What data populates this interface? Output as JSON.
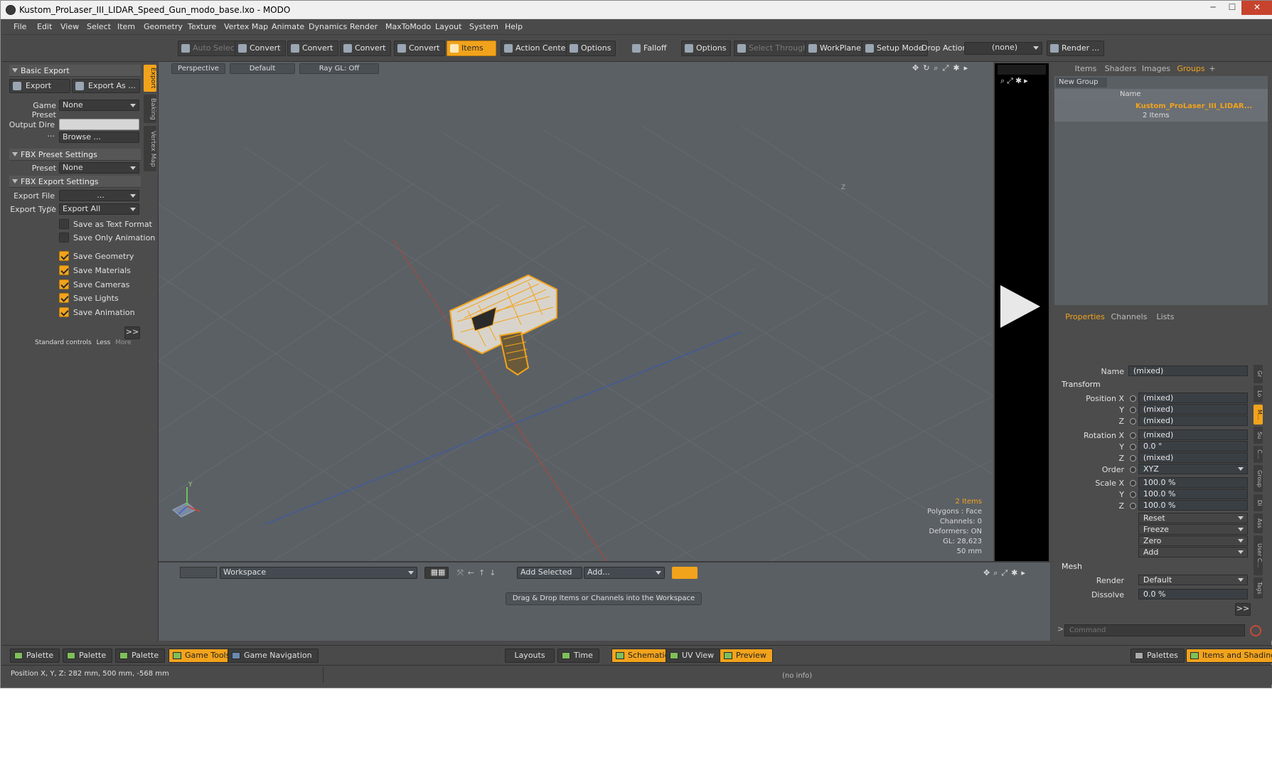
{
  "window": {
    "title": "Kustom_ProLaser_III_LIDAR_Speed_Gun_modo_base.lxo - MODO",
    "minimize": "─",
    "maximize": "☐",
    "close": "✕"
  },
  "menu": [
    "File",
    "Edit",
    "View",
    "Select",
    "Item",
    "Geometry",
    "Texture",
    "Vertex Map",
    "Animate",
    "Dynamics",
    "Render",
    "MaxToModo",
    "Layout",
    "System",
    "Help"
  ],
  "toolbar": {
    "auto_select": "Auto Select",
    "convert": "Convert",
    "items": "Items",
    "action_center": "Action Center",
    "options": "Options",
    "falloff": "Falloff",
    "select_through": "Select Through",
    "workplane": "WorkPlane",
    "setup_mode": "Setup Mode",
    "drop_action": "Drop Action",
    "drop_value": "(none)",
    "render": "Render ..."
  },
  "left": {
    "tabs": [
      "Export",
      "Baking",
      "Vertex Map"
    ],
    "basic_export": "Basic Export",
    "export_btn": "Export",
    "export_as_btn": "Export As ...",
    "game_preset_label": "Game Preset",
    "game_preset_value": "None",
    "output_dir_label": "Output Dire ...",
    "output_dir_value": "",
    "browse": "Browse ...",
    "fbx_preset_settings": "FBX Preset Settings",
    "preset_label": "Preset",
    "preset_value": "None",
    "fbx_export_settings": "FBX Export Settings",
    "export_file_label": "Export File ...",
    "export_file_value": "...",
    "export_type_label": "Export Type",
    "export_type_value": "Export All",
    "checkboxes": [
      {
        "label": "Save as Text Format",
        "checked": false
      },
      {
        "label": "Save Only Animation",
        "checked": false
      },
      {
        "label": "Save Geometry",
        "checked": true
      },
      {
        "label": "Save Materials",
        "checked": true
      },
      {
        "label": "Save Cameras",
        "checked": true
      },
      {
        "label": "Save Lights",
        "checked": true
      },
      {
        "label": "Save Animation",
        "checked": true
      }
    ],
    "expand": ">>",
    "standard_controls": "Standard controls",
    "less": "Less",
    "more": "More"
  },
  "viewport": {
    "perspective": "Perspective",
    "default": "Default",
    "raygl": "Ray GL: Off",
    "info_items": "2 Items",
    "info_polygons": "Polygons : Face",
    "info_channels": "Channels: 0",
    "info_deformers": "Deformers: ON",
    "info_gl": "GL: 28,623",
    "info_lens": "50 mm",
    "axis_y": "Y",
    "axis_z": "Z"
  },
  "workspace": {
    "dropdown": "Workspace",
    "add_selected": "Add Selected",
    "add": "Add...",
    "hint": "Drag & Drop Items or Channels into the Workspace"
  },
  "right": {
    "tabs": [
      "Items",
      "Shaders",
      "Images",
      "Groups"
    ],
    "new_group": "New Group",
    "col_name": "Name",
    "group_name": "Kustom_ProLaser_III_LIDAR...",
    "group_count": "2 Items",
    "prop_tabs": [
      "Properties",
      "Channels",
      "Lists"
    ],
    "name_label": "Name",
    "name_value": "(mixed)",
    "transform": "Transform",
    "position_x_label": "Position X",
    "pos": [
      "(mixed)",
      "(mixed)",
      "(mixed)"
    ],
    "rotation_x_label": "Rotation X",
    "rot": [
      "(mixed)",
      "0.0 °",
      "(mixed)"
    ],
    "y_label": "Y",
    "z_label": "Z",
    "order_label": "Order",
    "order_value": "XYZ",
    "scale_x_label": "Scale X",
    "scale": [
      "100.0 %",
      "100.0 %",
      "100.0 %"
    ],
    "reset": "Reset",
    "freeze": "Freeze",
    "zero": "Zero",
    "add": "Add",
    "mesh": "Mesh",
    "render_label": "Render",
    "render_value": "Default",
    "dissolve_label": "Dissolve",
    "dissolve_value": "0.0 %",
    "side_tabs": [
      "Gr",
      "Lo",
      "M...",
      "Su",
      "C...",
      "Group",
      "Di",
      "Ass",
      "User C...",
      "Tags"
    ],
    "command_placeholder": "Command",
    "expand": ">>"
  },
  "bottom": {
    "palette": "Palette",
    "game_tools": "Game Tools",
    "game_navigation": "Game Navigation",
    "layouts": "Layouts",
    "time": "Time",
    "schematic": "Schematic",
    "uv_view": "UV View",
    "preview": "Preview",
    "palettes": "Palettes",
    "items_and_shading": "Items and Shading"
  },
  "status": {
    "position": "Position X, Y, Z:  282 mm, 500 mm, -568 mm",
    "info": "(no info)"
  },
  "colors": {
    "accent": "#f2a31c",
    "viewport_bg": "#5b6065",
    "panel_bg": "#4c4c4c"
  }
}
